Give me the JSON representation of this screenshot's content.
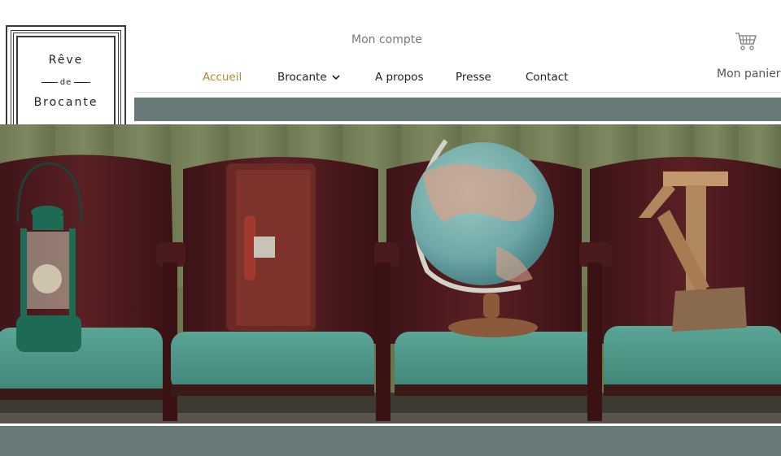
{
  "logo": {
    "line1": "Rêve",
    "line2": "de",
    "line3": "Brocante"
  },
  "header": {
    "account_label": "Mon compte",
    "cart_label": "Mon panier",
    "cart_icon": "cart-icon"
  },
  "nav": {
    "items": [
      {
        "label": "Accueil",
        "active": true
      },
      {
        "label": "Brocante",
        "has_dropdown": true
      },
      {
        "label": "A propos"
      },
      {
        "label": "Presse"
      },
      {
        "label": "Contact"
      }
    ]
  },
  "colors": {
    "accent": "#b28a37",
    "band": "#677a78",
    "text": "#222222",
    "muted": "#777777"
  }
}
